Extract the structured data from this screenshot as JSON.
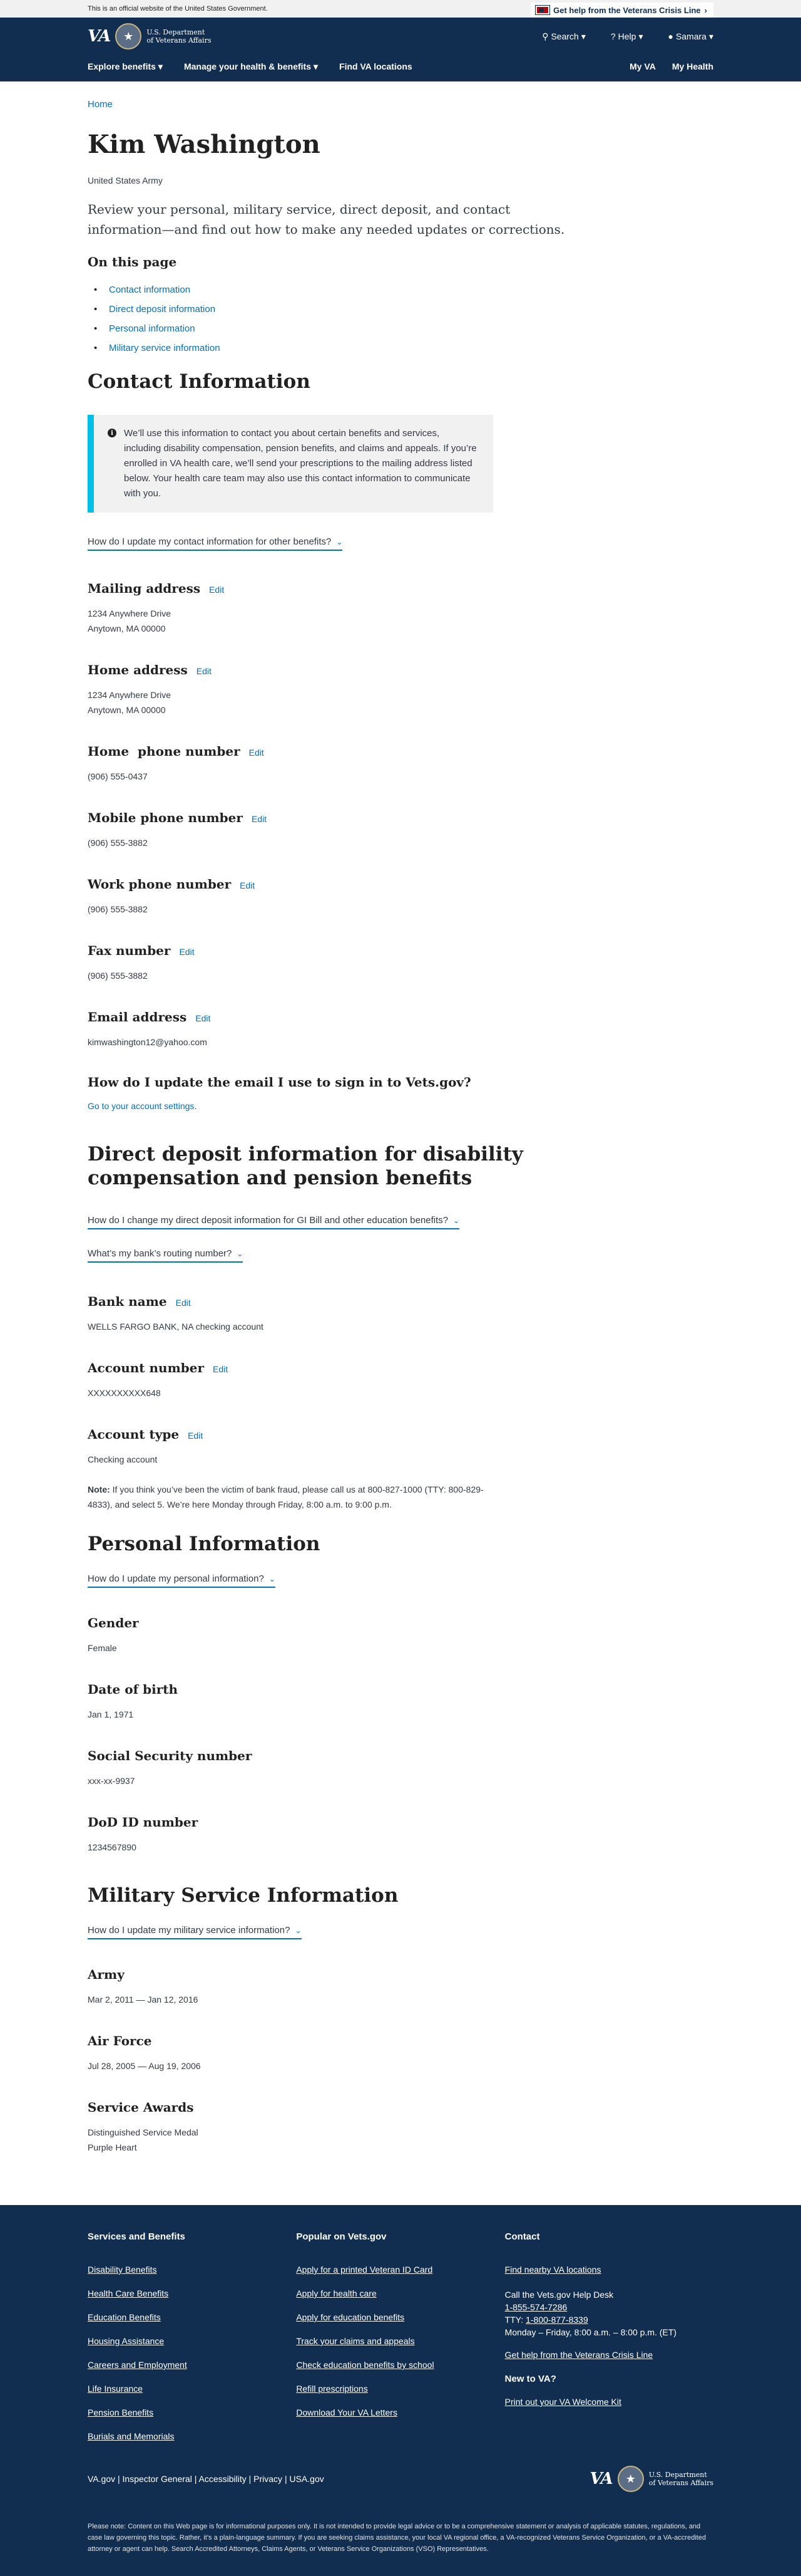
{
  "banner": {
    "text": "This is an official website of the United States Government.",
    "crisis": "Get help from the Veterans Crisis Line"
  },
  "header": {
    "logo_text": "VA",
    "dept_line1": "U.S. Department",
    "dept_line2": "of Veterans Affairs",
    "search": "Search",
    "help": "Help",
    "user": "Samara",
    "nav": [
      "Explore benefits",
      "Manage your health & benefits",
      "Find VA locations"
    ],
    "nav_right": [
      "My VA",
      "My Health"
    ]
  },
  "breadcrumb": "Home",
  "profile": {
    "name": "Kim Washington",
    "branch": "United States Army",
    "lead": "Review your personal, military service, direct deposit, and contact information—and find out how to make any needed updates or corrections.",
    "on_this_page": "On this page",
    "toc": [
      "Contact information",
      "Direct deposit information",
      "Personal information",
      "Military service information"
    ]
  },
  "contact": {
    "title": "Contact Information",
    "alert": "We’ll use this information to contact you about certain benefits and services, including disability compensation, pension benefits, and claims and appeals. If you’re enrolled in VA health care, we’ll send your prescriptions to the mailing address listed below. Your health care team may also use this contact information to communicate with you.",
    "accordion": "How do I update my contact information for other benefits?",
    "edit": "Edit",
    "mailing_label": "Mailing address",
    "mailing_line1": "1234 Anywhere Drive",
    "mailing_line2": "Anytown, MA 00000",
    "home_label": "Home address",
    "home_line1": "1234 Anywhere Drive",
    "home_line2": "Anytown, MA 00000",
    "home_phone_label": "Home  phone number",
    "home_phone": "(906) 555-0437",
    "mobile_label": "Mobile phone number",
    "mobile": "(906) 555-3882",
    "work_label": "Work phone number",
    "work": "(906) 555-3882",
    "fax_label": "Fax number",
    "fax": "(906) 555-3882",
    "email_label": "Email address",
    "email": "kimwashington12@yahoo.com",
    "signin_q": "How do I update the email I use to sign in to Vets.gov?",
    "signin_link": "Go to your account settings",
    "signin_period": "."
  },
  "deposit": {
    "title": "Direct deposit information for disability compensation and pension benefits",
    "acc1": "How do I change my direct deposit information for GI Bill and other education benefits?",
    "acc2": "What’s my bank’s routing number?",
    "bank_label": "Bank name",
    "bank": "WELLS FARGO BANK, NA checking account",
    "acct_label": "Account number",
    "acct": "XXXXXXXXXX648",
    "type_label": "Account type",
    "type": "Checking account",
    "note_label": "Note:",
    "note": " If you think you’ve been the victim of bank fraud, please call us at 800-827-1000 (TTY: 800-829-4833), and select 5. We’re here Monday through Friday, 8:00 a.m. to 9:00 p.m."
  },
  "personal": {
    "title": "Personal Information",
    "accordion": "How do I update my personal information?",
    "gender_label": "Gender",
    "gender": "Female",
    "dob_label": "Date of birth",
    "dob": "Jan 1, 1971",
    "ssn_label": "Social Security number",
    "ssn": "xxx-xx-9937",
    "dod_label": "DoD ID number",
    "dod": "1234567890"
  },
  "military": {
    "title": "Military Service Information",
    "accordion": "How do I update my military service information?",
    "army_label": "Army",
    "army": "Mar 2, 2011 — Jan 12, 2016",
    "af_label": "Air Force",
    "af": "Jul 28, 2005 — Aug 19, 2006",
    "awards_label": "Service Awards",
    "award1": "Distinguished Service Medal",
    "award2": "Purple Heart"
  },
  "footer": {
    "col1_title": "Services and Benefits",
    "col1": [
      "Disability Benefits",
      "Health Care Benefits",
      "Education Benefits",
      "Housing Assistance",
      "Careers and Employment",
      "Life Insurance",
      "Pension Benefits",
      "Burials and Memorials"
    ],
    "col2_title": "Popular on Vets.gov",
    "col2": [
      "Apply for a printed Veteran ID Card",
      "Apply for health care",
      "Apply for education benefits",
      "Track your claims and appeals",
      "Check education benefits by school",
      "Refill prescriptions",
      "Download Your VA Letters"
    ],
    "col3_title": "Contact",
    "find": "Find nearby VA locations",
    "call": "Call the Vets.gov Help Desk",
    "phone": "1-855-574-7286",
    "tty_label": "TTY: ",
    "tty": "1-800-877-8339",
    "hours": "Monday – Friday, 8:00 a.m. – 8:00 p.m. (ET)",
    "crisis": "Get help from the Veterans Crisis Line",
    "new_title": "New to VA?",
    "welcome": "Print out your VA Welcome Kit",
    "bottom_links": [
      "VA.gov",
      "Inspector General",
      "Accessibility",
      "Privacy",
      "USA.gov"
    ],
    "sep": " | ",
    "disclaimer": "Please note: Content on this Web page is for informational purposes only. It is not intended to provide legal advice or to be a comprehensive statement or analysis of applicable statutes, regulations, and case law governing this topic. Rather, it’s a plain-language summary. If you are seeking claims assistance, your local VA regional office, a VA-recognized Veterans Service Organization, or a VA-accredited attorney or agent can help. Search Accredited Attorneys, Claims Agents, or Veterans Service Organizations (VSO) Representatives."
  }
}
